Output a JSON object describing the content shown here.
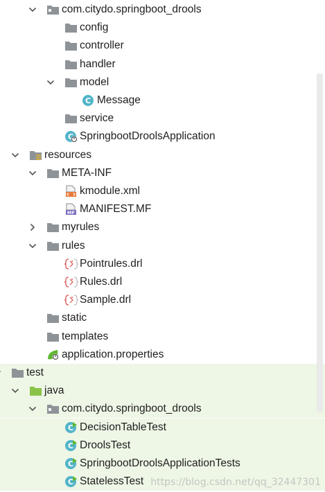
{
  "colors": {
    "folder": "#8e9398",
    "source_folder": "#8bc34a",
    "class_circle": "#53b5c9",
    "spring": "#5fb832",
    "xml": "#e87a3a",
    "mf": "#7b6ec0",
    "drl": "#d9534f",
    "highlight": "#eef6e6"
  },
  "tree": {
    "items": [
      {
        "label": "com.citydo.springboot_drools",
        "icon": "package-icon",
        "arrow": "expanded",
        "level": 4,
        "highlight": false
      },
      {
        "label": "config",
        "icon": "folder-icon",
        "arrow": "none",
        "level": 5,
        "highlight": false
      },
      {
        "label": "controller",
        "icon": "folder-icon",
        "arrow": "none",
        "level": 5,
        "highlight": false
      },
      {
        "label": "handler",
        "icon": "folder-icon",
        "arrow": "none",
        "level": 5,
        "highlight": false
      },
      {
        "label": "model",
        "icon": "folder-icon",
        "arrow": "expanded",
        "level": 5,
        "highlight": false
      },
      {
        "label": "Message",
        "icon": "class-icon",
        "arrow": "none",
        "level": 6,
        "highlight": false
      },
      {
        "label": "service",
        "icon": "folder-icon",
        "arrow": "none",
        "level": 5,
        "highlight": false
      },
      {
        "label": "SpringbootDroolsApplication",
        "icon": "spring-boot-class-icon",
        "arrow": "none",
        "level": 5,
        "highlight": false
      },
      {
        "label": "resources",
        "icon": "resources-folder-icon",
        "arrow": "expanded",
        "level": 3,
        "highlight": false
      },
      {
        "label": "META-INF",
        "icon": "folder-icon",
        "arrow": "expanded",
        "level": 4,
        "highlight": false
      },
      {
        "label": "kmodule.xml",
        "icon": "xml-file-icon",
        "arrow": "none",
        "level": 5,
        "highlight": false
      },
      {
        "label": "MANIFEST.MF",
        "icon": "manifest-file-icon",
        "arrow": "none",
        "level": 5,
        "highlight": false
      },
      {
        "label": "myrules",
        "icon": "folder-icon",
        "arrow": "collapsed",
        "level": 4,
        "highlight": false
      },
      {
        "label": "rules",
        "icon": "folder-icon",
        "arrow": "expanded",
        "level": 4,
        "highlight": false
      },
      {
        "label": "Pointrules.drl",
        "icon": "drl-file-icon",
        "arrow": "none",
        "level": 5,
        "highlight": false
      },
      {
        "label": "Rules.drl",
        "icon": "drl-file-icon",
        "arrow": "none",
        "level": 5,
        "highlight": false
      },
      {
        "label": "Sample.drl",
        "icon": "drl-file-icon",
        "arrow": "none",
        "level": 5,
        "highlight": false
      },
      {
        "label": "static",
        "icon": "folder-icon",
        "arrow": "none",
        "level": 4,
        "highlight": false
      },
      {
        "label": "templates",
        "icon": "folder-icon",
        "arrow": "none",
        "level": 4,
        "highlight": false
      },
      {
        "label": "application.properties",
        "icon": "spring-properties-icon",
        "arrow": "none",
        "level": 4,
        "highlight": false
      },
      {
        "label": "test",
        "icon": "folder-icon",
        "arrow": "expanded",
        "level": 2,
        "highlight": true
      },
      {
        "label": "java",
        "icon": "test-source-folder-icon",
        "arrow": "expanded",
        "level": 3,
        "highlight": true
      },
      {
        "label": "com.citydo.springboot_drools",
        "icon": "package-icon",
        "arrow": "expanded",
        "level": 4,
        "highlight": true
      },
      {
        "label": "DecisionTableTest",
        "icon": "test-class-icon",
        "arrow": "none",
        "level": 5,
        "highlight": true
      },
      {
        "label": "DroolsTest",
        "icon": "test-class-icon",
        "arrow": "none",
        "level": 5,
        "highlight": true
      },
      {
        "label": "SpringbootDroolsApplicationTests",
        "icon": "test-class-icon",
        "arrow": "none",
        "level": 5,
        "highlight": true
      },
      {
        "label": "StatelessTest",
        "icon": "test-class-icon",
        "arrow": "none",
        "level": 5,
        "highlight": true
      }
    ]
  },
  "watermark": "https://blog.csdn.net/qq_32447301"
}
